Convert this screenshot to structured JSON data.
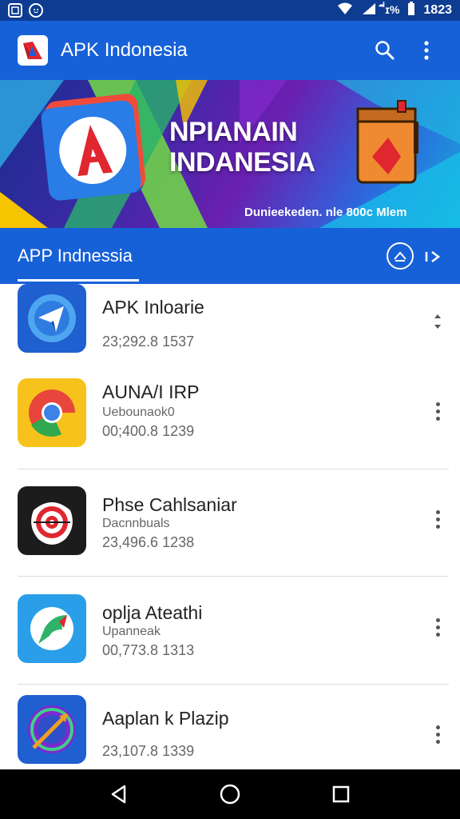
{
  "status_bar": {
    "time": "1823",
    "battery_text": "ี่ɪ%"
  },
  "app_bar": {
    "title": "APK Indonesia"
  },
  "banner": {
    "heading_line1": "NPIANAIN",
    "heading_line2": "INDANESIA",
    "subtitle": "Dunieekeden. nle 800c Mlem"
  },
  "tab_bar": {
    "label": "APP Indnessia"
  },
  "apps": [
    {
      "name": "APK Inloarie",
      "developer": "",
      "meta": "23;292.8 1537",
      "icon": "telegram-style-icon"
    },
    {
      "name": "AUNA/I IRP",
      "developer": "Uebounaok0",
      "meta": "00;400.8 1239",
      "icon": "chrome-style-icon"
    },
    {
      "name": "Phse Cahlsaniar",
      "developer": "Dacnnbuals",
      "meta": "23,496.6 1238",
      "icon": "target-style-icon"
    },
    {
      "name": "oplja Ateathi",
      "developer": "Upanneak",
      "meta": "00,773.8 1313",
      "icon": "bird-style-icon"
    },
    {
      "name": "Aaplan k Plazip",
      "developer": "",
      "meta": "23,107.8 1339",
      "icon": "arrow-circle-icon"
    }
  ],
  "colors": {
    "primary": "#1761d8",
    "status_bar": "#0d3c91",
    "nav_bar": "#000000"
  }
}
